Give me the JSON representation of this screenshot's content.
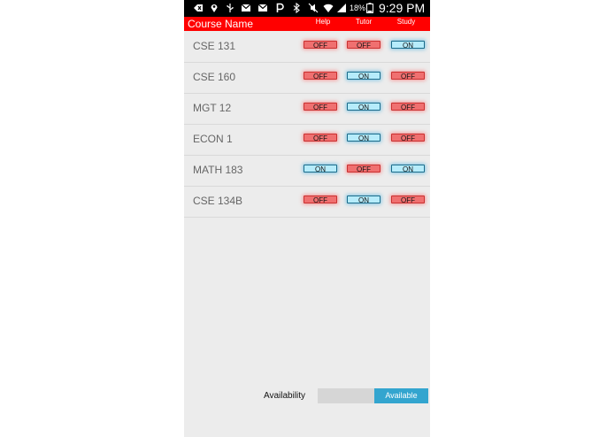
{
  "status_bar": {
    "battery_percent": "18%",
    "time": "9:29 PM",
    "icons": [
      "back-icon",
      "location-icon",
      "usb-icon",
      "gmail-icon",
      "gmail-icon",
      "p-icon",
      "bluetooth-icon",
      "mute-icon",
      "wifi-icon",
      "signal-icon",
      "battery-icon"
    ]
  },
  "header": {
    "course_label": "Course Name",
    "help_label": "Help",
    "tutor_label": "Tutor",
    "study_label": "Study"
  },
  "courses": [
    {
      "name": "CSE 131",
      "help": "OFF",
      "tutor": "OFF",
      "study": "ON"
    },
    {
      "name": "CSE 160",
      "help": "OFF",
      "tutor": "ON",
      "study": "OFF"
    },
    {
      "name": "MGT 12",
      "help": "OFF",
      "tutor": "ON",
      "study": "OFF"
    },
    {
      "name": "ECON 1",
      "help": "OFF",
      "tutor": "ON",
      "study": "OFF"
    },
    {
      "name": "MATH 183",
      "help": "ON",
      "tutor": "OFF",
      "study": "ON"
    },
    {
      "name": "CSE 134B",
      "help": "OFF",
      "tutor": "ON",
      "study": "OFF"
    }
  ],
  "availability": {
    "label": "Availability",
    "state": "Available"
  },
  "colors": {
    "header_red": "#ff0000",
    "on_blue": "#b6ecfb",
    "off_red": "#f07070",
    "available_blue": "#33a5cf"
  }
}
